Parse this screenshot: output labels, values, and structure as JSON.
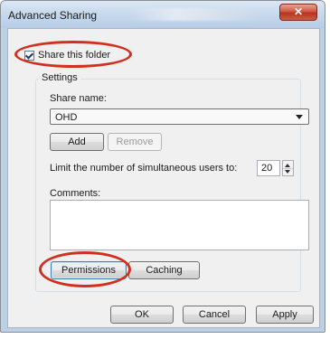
{
  "window": {
    "title": "Advanced Sharing",
    "close_glyph": "✕"
  },
  "share": {
    "label": "Share this folder",
    "checked": true
  },
  "settings": {
    "group_label": "Settings",
    "share_name_label": "Share name:",
    "share_name_value": "OHD",
    "add_label": "Add",
    "remove_label": "Remove",
    "limit_label": "Limit the number of simultaneous users to:",
    "limit_value": "20",
    "comments_label": "Comments:",
    "permissions_label": "Permissions",
    "caching_label": "Caching"
  },
  "footer": {
    "ok_label": "OK",
    "cancel_label": "Cancel",
    "apply_label": "Apply"
  },
  "colors": {
    "highlight": "#d2301f",
    "close_button": "#c8412c"
  },
  "icons": [
    "close-icon",
    "dropdown-arrow-icon",
    "spin-up-icon",
    "spin-down-icon",
    "checkmark-icon"
  ]
}
